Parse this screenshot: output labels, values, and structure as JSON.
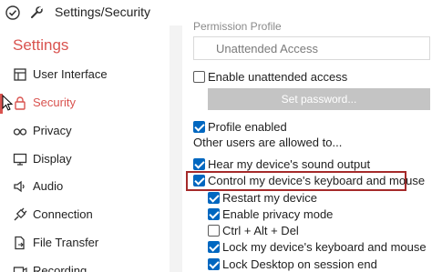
{
  "titlebar": {
    "title": "Settings/Security",
    "check_icon": "check-icon",
    "wrench_icon": "wrench-icon"
  },
  "sidebar": {
    "heading": "Settings",
    "items": [
      {
        "label": "User Interface",
        "icon": "user-interface-icon"
      },
      {
        "label": "Security",
        "icon": "lock-icon",
        "active": true
      },
      {
        "label": "Privacy",
        "icon": "glasses-icon"
      },
      {
        "label": "Display",
        "icon": "monitor-icon"
      },
      {
        "label": "Audio",
        "icon": "speaker-icon"
      },
      {
        "label": "Connection",
        "icon": "plug-icon"
      },
      {
        "label": "File Transfer",
        "icon": "file-transfer-icon"
      },
      {
        "label": "Recording",
        "icon": "recording-icon"
      }
    ],
    "accent_color": "#d9534f"
  },
  "main": {
    "section_header": "Permission Profile",
    "profile_dropdown": {
      "value": "Unattended Access"
    },
    "enable_unattended": {
      "label": "Enable unattended access",
      "checked": false
    },
    "set_password_button": "Set password...",
    "profile_enabled": {
      "label": "Profile enabled",
      "checked": true
    },
    "allowed_text": "Other users are allowed to...",
    "permissions": [
      {
        "label": "Hear my device's sound output",
        "checked": true
      },
      {
        "label": "Control my device's keyboard and mouse",
        "checked": true,
        "highlighted": true
      },
      {
        "label": "Restart my device",
        "checked": true
      },
      {
        "label": "Enable privacy mode",
        "checked": true
      },
      {
        "label": "Ctrl + Alt + Del",
        "checked": false
      },
      {
        "label": "Lock my device's keyboard and mouse",
        "checked": true
      },
      {
        "label": "Lock Desktop on session end",
        "checked": true
      }
    ],
    "checkbox_color": "#0067c0",
    "highlight_color": "#a52a2a"
  }
}
